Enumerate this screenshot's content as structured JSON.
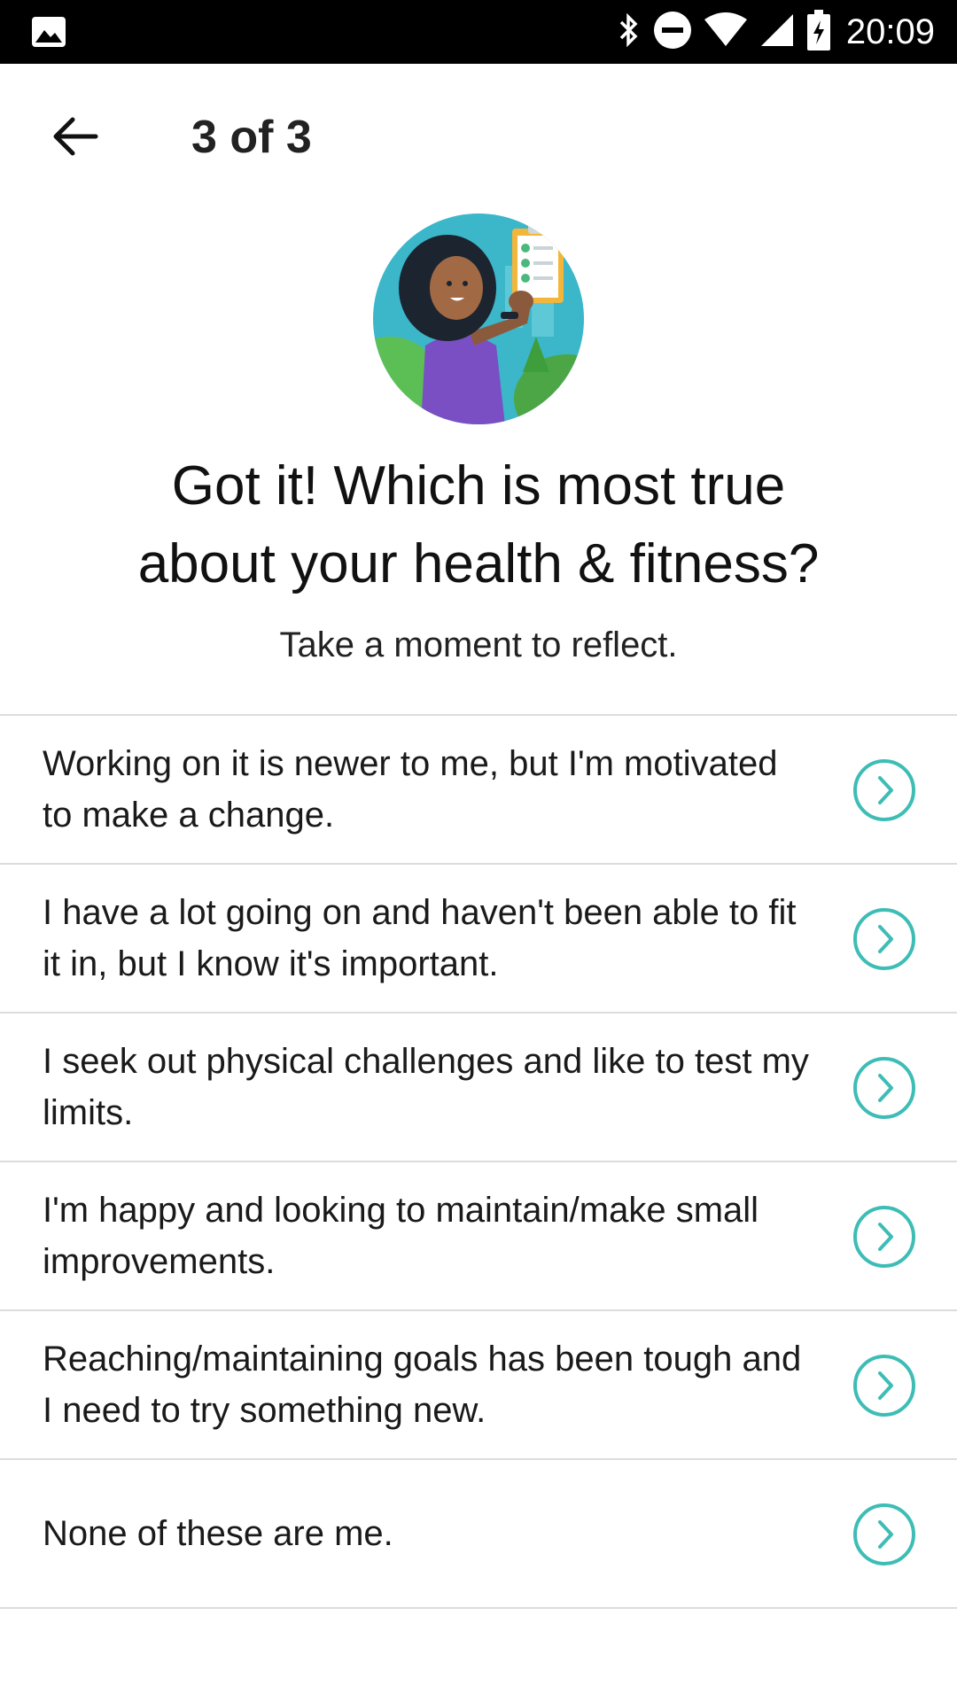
{
  "status_bar": {
    "time": "20:09",
    "icons": [
      "gallery-icon",
      "bluetooth-icon",
      "do-not-disturb-icon",
      "wifi-icon",
      "cellular-signal-icon",
      "battery-charging-icon"
    ]
  },
  "header": {
    "back_icon": "arrow-left-icon",
    "step": "3 of 3"
  },
  "main": {
    "headline_line1": "Got it! Which is most true",
    "headline_line2": "about your health & fitness?",
    "subheadline": "Take a moment to reflect.",
    "options": [
      {
        "label": "Working on it is newer to me, but I'm motivated to make a change."
      },
      {
        "label": "I have a lot going on and haven't been able to fit it in, but I know it's important."
      },
      {
        "label": "I seek out physical challenges and like to test my limits."
      },
      {
        "label": "I'm happy and looking to maintain/make small improvements."
      },
      {
        "label": "Reaching/maintaining goals has been tough and I need to try something new."
      },
      {
        "label": "None of these are me."
      }
    ]
  },
  "colors": {
    "accent": "#3dbdb5",
    "divider": "#dcdcdc",
    "status_bar_bg": "#000000"
  }
}
